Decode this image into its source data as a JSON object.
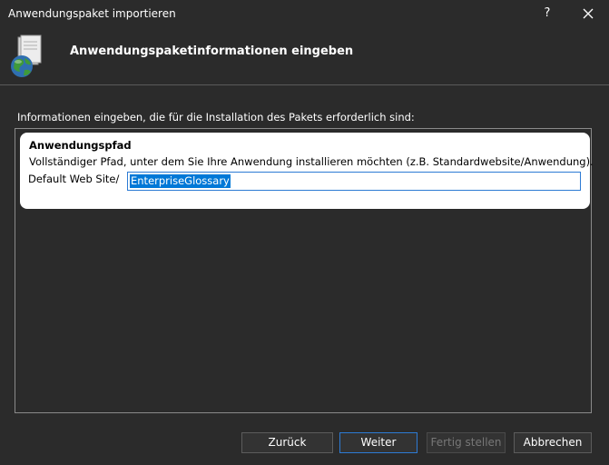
{
  "window": {
    "title": "Anwendungspaket importieren",
    "help_label": "?",
    "close_icon": "close-icon"
  },
  "header": {
    "title": "Anwendungspaketinformationen eingeben",
    "icon": "package-globe-icon"
  },
  "main": {
    "instructions": "Informationen eingeben, die für die Installation des Pakets erforderlich sind:",
    "parameter": {
      "name": "Anwendungspfad",
      "description": "Vollständiger Pfad, unter dem Sie Ihre Anwendung installieren möchten (z.B. Standardwebsite/Anwendung).",
      "prefix": "Default Web Site/",
      "value": "EnterpriseGlossary"
    }
  },
  "buttons": {
    "back": "Zurück",
    "next": "Weiter",
    "finish": "Fertig stellen",
    "cancel": "Abbrechen"
  },
  "colors": {
    "background": "#2b2b2b",
    "selection": "#0078d7",
    "focus_border": "#2d7bd4"
  }
}
